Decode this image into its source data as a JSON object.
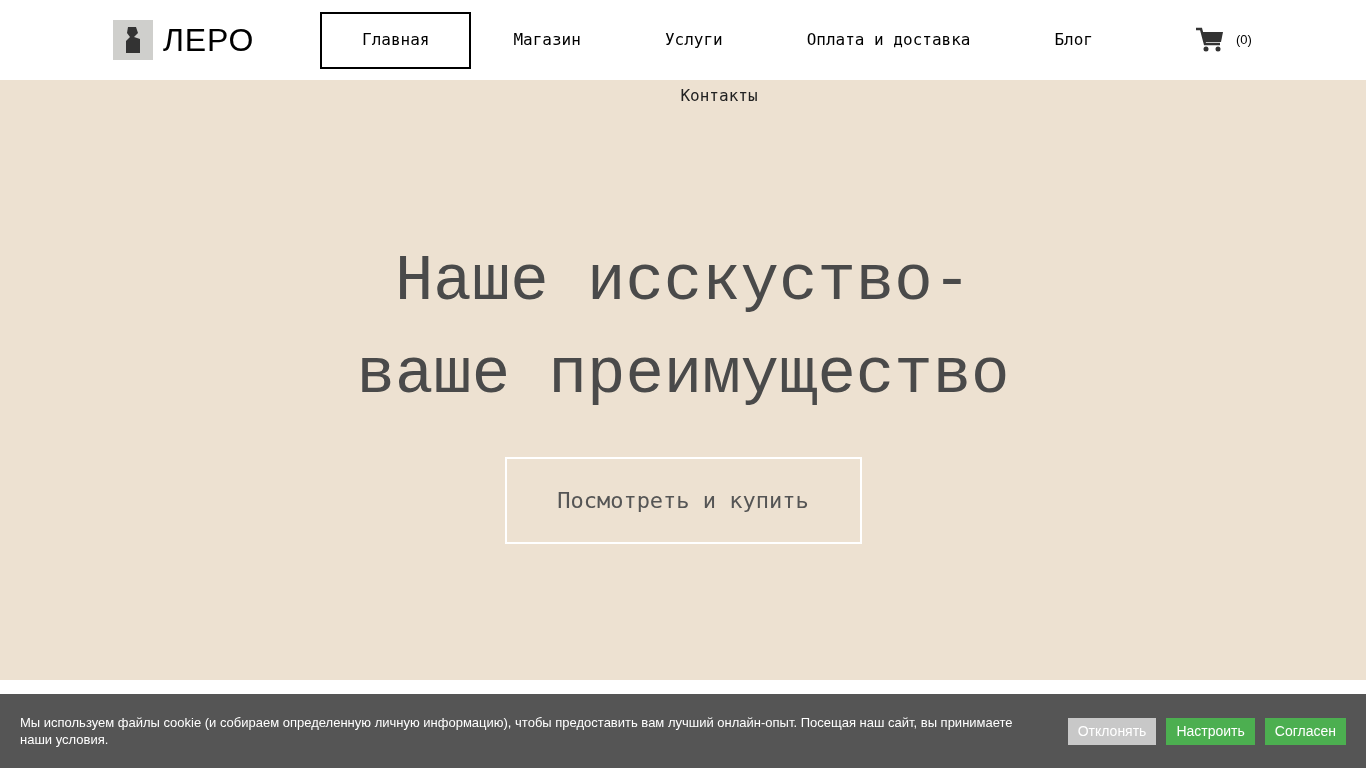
{
  "header": {
    "logo_text": "ЛЕРО",
    "cart_count": "(0)"
  },
  "nav": {
    "items": [
      {
        "label": "Главная",
        "selected": true
      },
      {
        "label": "Магазин",
        "selected": false
      },
      {
        "label": "Услуги",
        "selected": false
      },
      {
        "label": "Оплата и доставка",
        "selected": false
      },
      {
        "label": "Блог",
        "selected": false
      },
      {
        "label": "Контакты",
        "selected": false
      }
    ]
  },
  "hero": {
    "title_lines": [
      "Наше исскуство-",
      "ваше преимущество"
    ],
    "button": "Посмотреть и купить"
  },
  "cookie_bar": {
    "text": "Мы используем файлы cookie (и собираем определенную личную информацию), чтобы предоставить вам лучший онлайн-опыт. Посещая наш сайт, вы принимаете наши условия.",
    "buttons": [
      {
        "label": "Отклонять",
        "kind": "reject"
      },
      {
        "label": "Настроить",
        "kind": "settings"
      },
      {
        "label": "Согласен",
        "kind": "accept"
      }
    ]
  }
}
